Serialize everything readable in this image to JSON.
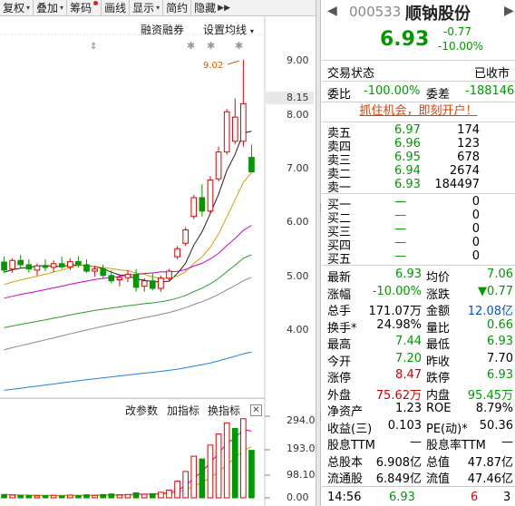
{
  "toolbar": {
    "items": [
      {
        "label": "复权",
        "arrow": "▾"
      },
      {
        "label": "叠加",
        "arrow": "▾"
      },
      {
        "label": "筹码",
        "arrow": ""
      },
      {
        "label": "画线",
        "arrow": ""
      },
      {
        "label": "显示",
        "arrow": "▾"
      },
      {
        "label": "简约",
        "arrow": ""
      },
      {
        "label": "隐藏",
        "arrow": ""
      }
    ],
    "more": "▶▶"
  },
  "chart_top": {
    "margin_trading": "融资融券",
    "set_ma": "设置均线",
    "set_ma_arrow": "▾",
    "high_marker": "9.02"
  },
  "price_axis": [
    "9.00",
    "8.15",
    "8.00",
    "7.00",
    "6.00",
    "5.00",
    "4.00"
  ],
  "indicator_bar": {
    "modify": "改参数",
    "add": "加指标",
    "switch": "换指标",
    "close": "✕"
  },
  "volume_axis": [
    "294.00",
    "193.00",
    "98.10",
    "0.00"
  ],
  "colors": {
    "up": "#e00000",
    "down": "#009900",
    "ma5": "#222222",
    "ma10": "#d4a000",
    "ma20": "#cc00cc",
    "ma30": "#2a9d2a",
    "ma60": "#888888",
    "ma120": "#2080e0"
  },
  "chart_data": {
    "type": "candlestick",
    "candles": [
      {
        "o": 5.25,
        "h": 5.35,
        "l": 5.05,
        "c": 5.1
      },
      {
        "o": 5.12,
        "h": 5.32,
        "l": 5.05,
        "c": 5.28
      },
      {
        "o": 5.28,
        "h": 5.38,
        "l": 5.14,
        "c": 5.2
      },
      {
        "o": 5.2,
        "h": 5.3,
        "l": 5.05,
        "c": 5.12
      },
      {
        "o": 5.1,
        "h": 5.22,
        "l": 5.0,
        "c": 5.18
      },
      {
        "o": 5.18,
        "h": 5.3,
        "l": 5.08,
        "c": 5.15
      },
      {
        "o": 5.15,
        "h": 5.28,
        "l": 5.06,
        "c": 5.22
      },
      {
        "o": 5.22,
        "h": 5.35,
        "l": 5.12,
        "c": 5.16
      },
      {
        "o": 5.16,
        "h": 5.32,
        "l": 5.1,
        "c": 5.26
      },
      {
        "o": 5.26,
        "h": 5.36,
        "l": 5.15,
        "c": 5.2
      },
      {
        "o": 5.2,
        "h": 5.3,
        "l": 5.05,
        "c": 5.08
      },
      {
        "o": 5.08,
        "h": 5.18,
        "l": 4.98,
        "c": 5.12
      },
      {
        "o": 5.12,
        "h": 5.2,
        "l": 4.95,
        "c": 5.0
      },
      {
        "o": 5.0,
        "h": 5.1,
        "l": 4.85,
        "c": 4.9
      },
      {
        "o": 4.92,
        "h": 5.02,
        "l": 4.8,
        "c": 4.96
      },
      {
        "o": 4.96,
        "h": 5.1,
        "l": 4.88,
        "c": 5.02
      },
      {
        "o": 5.02,
        "h": 5.12,
        "l": 4.7,
        "c": 4.78
      },
      {
        "o": 4.8,
        "h": 4.95,
        "l": 4.7,
        "c": 4.9
      },
      {
        "o": 4.9,
        "h": 5.05,
        "l": 4.72,
        "c": 4.76
      },
      {
        "o": 4.76,
        "h": 5.0,
        "l": 4.7,
        "c": 4.95
      },
      {
        "o": 4.95,
        "h": 5.12,
        "l": 4.9,
        "c": 5.08
      },
      {
        "o": 5.35,
        "h": 5.55,
        "l": 5.3,
        "c": 5.5
      },
      {
        "o": 5.6,
        "h": 5.9,
        "l": 5.55,
        "c": 5.85
      },
      {
        "o": 6.1,
        "h": 6.5,
        "l": 6.05,
        "c": 6.45
      },
      {
        "o": 6.45,
        "h": 6.7,
        "l": 6.1,
        "c": 6.2
      },
      {
        "o": 6.2,
        "h": 6.85,
        "l": 6.15,
        "c": 6.78
      },
      {
        "o": 6.8,
        "h": 7.4,
        "l": 6.75,
        "c": 7.3
      },
      {
        "o": 7.3,
        "h": 8.1,
        "l": 7.25,
        "c": 8.05
      },
      {
        "o": 7.5,
        "h": 8.3,
        "l": 7.45,
        "c": 7.95
      },
      {
        "o": 7.5,
        "h": 9.02,
        "l": 7.4,
        "c": 8.2
      },
      {
        "o": 7.2,
        "h": 7.44,
        "l": 6.93,
        "c": 6.93
      }
    ],
    "volumes": [
      {
        "v": 12,
        "up": false
      },
      {
        "v": 10,
        "up": true
      },
      {
        "v": 8,
        "up": false
      },
      {
        "v": 9,
        "up": false
      },
      {
        "v": 7,
        "up": true
      },
      {
        "v": 8,
        "up": false
      },
      {
        "v": 9,
        "up": true
      },
      {
        "v": 7,
        "up": false
      },
      {
        "v": 10,
        "up": true
      },
      {
        "v": 8,
        "up": false
      },
      {
        "v": 11,
        "up": false
      },
      {
        "v": 9,
        "up": true
      },
      {
        "v": 12,
        "up": false
      },
      {
        "v": 14,
        "up": false
      },
      {
        "v": 10,
        "up": true
      },
      {
        "v": 12,
        "up": true
      },
      {
        "v": 18,
        "up": false
      },
      {
        "v": 13,
        "up": true
      },
      {
        "v": 15,
        "up": false
      },
      {
        "v": 20,
        "up": true
      },
      {
        "v": 28,
        "up": true
      },
      {
        "v": 60,
        "up": true
      },
      {
        "v": 95,
        "up": true
      },
      {
        "v": 150,
        "up": true
      },
      {
        "v": 140,
        "up": false
      },
      {
        "v": 190,
        "up": true
      },
      {
        "v": 230,
        "up": true
      },
      {
        "v": 270,
        "up": true
      },
      {
        "v": 250,
        "up": false
      },
      {
        "v": 285,
        "up": true
      },
      {
        "v": 171,
        "up": false
      }
    ],
    "ylim": [
      3.8,
      9.3
    ],
    "vol_ylim": [
      0,
      294
    ]
  },
  "quote": {
    "prev": "◀",
    "next": "▶",
    "code": "000533",
    "name": "顺钠股份",
    "price": "6.93",
    "change": "-0.77",
    "change_pct": "-10.00%",
    "status_label": "交易状态",
    "status_value": "已收市",
    "weibi_label": "委比",
    "weibi_value": "-100.00%",
    "weicha_label": "委差",
    "weicha_value": "-188146",
    "banner": "抓住机会，即刻开户！",
    "sells": [
      {
        "label": "卖五",
        "price": "6.97",
        "vol": "174"
      },
      {
        "label": "卖四",
        "price": "6.96",
        "vol": "123"
      },
      {
        "label": "卖三",
        "price": "6.95",
        "vol": "678"
      },
      {
        "label": "卖二",
        "price": "6.94",
        "vol": "2674"
      },
      {
        "label": "卖一",
        "price": "6.93",
        "vol": "184497"
      }
    ],
    "buys": [
      {
        "label": "买一",
        "price": "—",
        "vol": "0"
      },
      {
        "label": "买二",
        "price": "—",
        "vol": "0"
      },
      {
        "label": "买三",
        "price": "—",
        "vol": "0"
      },
      {
        "label": "买四",
        "price": "—",
        "vol": "0"
      },
      {
        "label": "买五",
        "price": "—",
        "vol": "0"
      }
    ],
    "stats": [
      {
        "l1": "最新",
        "v1": "6.93",
        "c1": "#009900",
        "l2": "均价",
        "v2": "7.06",
        "c2": "#009900"
      },
      {
        "l1": "涨幅",
        "v1": "-10.00%",
        "c1": "#009900",
        "l2": "涨跌",
        "v2": "▼0.77",
        "c2": "#009900"
      },
      {
        "l1": "总手",
        "v1": "171.07万",
        "c1": "#000000",
        "l2": "金额",
        "v2": "12.08亿",
        "c2": "#0055cc"
      },
      {
        "l1": "换手*",
        "v1": "24.98%",
        "c1": "#000000",
        "l2": "量比",
        "v2": "0.66",
        "c2": "#009900"
      },
      {
        "l1": "最高",
        "v1": "7.44",
        "c1": "#009900",
        "l2": "最低",
        "v2": "6.93",
        "c2": "#009900"
      },
      {
        "l1": "今开",
        "v1": "7.20",
        "c1": "#009900",
        "l2": "昨收",
        "v2": "7.70",
        "c2": "#000000"
      },
      {
        "l1": "涨停",
        "v1": "8.47",
        "c1": "#cc0000",
        "l2": "跌停",
        "v2": "6.93",
        "c2": "#009900"
      },
      {
        "l1": "外盘",
        "v1": "75.62万",
        "c1": "#cc0000",
        "l2": "内盘",
        "v2": "95.45万",
        "c2": "#009900"
      },
      {
        "l1": "净资产",
        "v1": "1.23",
        "c1": "#000000",
        "l2": "ROE",
        "v2": "8.79%",
        "c2": "#000000"
      },
      {
        "l1": "收益(三)",
        "v1": "0.103",
        "c1": "#000000",
        "l2": "PE(动)*",
        "v2": "50.36",
        "c2": "#000000"
      },
      {
        "l1": "股息TTM",
        "v1": "—",
        "c1": "#000000",
        "l2": "股息率TTM",
        "v2": "—",
        "c2": "#000000"
      },
      {
        "l1": "总股本",
        "v1": "6.908亿",
        "c1": "#000000",
        "l2": "总值",
        "v2": "47.87亿",
        "c2": "#000000"
      },
      {
        "l1": "流通股",
        "v1": "6.849亿",
        "c1": "#000000",
        "l2": "流值",
        "v2": "47.46亿",
        "c2": "#000000"
      }
    ],
    "last_time": "14:56",
    "last_price": "6.93",
    "last_vol": "6",
    "last_count": "3"
  }
}
